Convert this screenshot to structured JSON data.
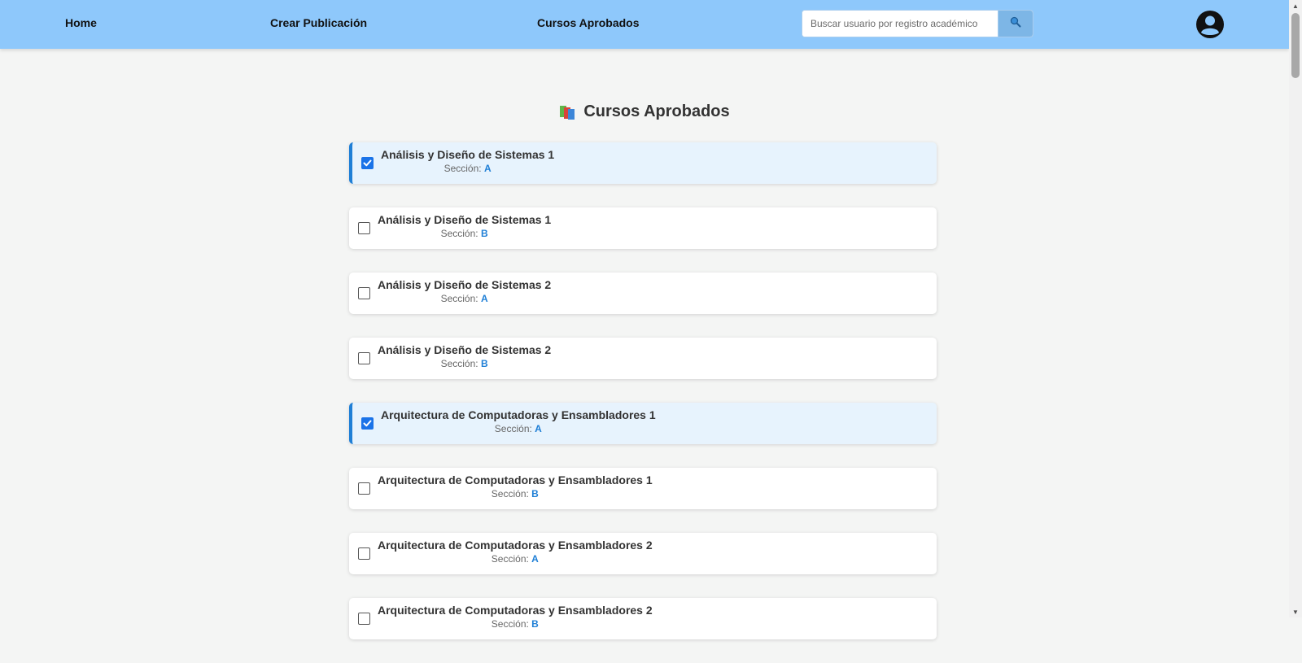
{
  "nav": {
    "home": "Home",
    "create_post": "Crear Publicación",
    "approved_courses": "Cursos Aprobados"
  },
  "search": {
    "placeholder": "Buscar usuario por registro académico",
    "value": "",
    "button_icon": "search-icon"
  },
  "user": {
    "icon": "user-avatar-icon"
  },
  "page": {
    "title": "Cursos Aprobados",
    "title_icon": "books-icon"
  },
  "section_label": "Sección:",
  "colors": {
    "navbar": "#8ec8fb",
    "accent": "#1f7fd6",
    "checked_bg": "#e7f3fd"
  },
  "courses": [
    {
      "name": "Análisis y Diseño de Sistemas 1",
      "section": "A",
      "checked": true
    },
    {
      "name": "Análisis y Diseño de Sistemas 1",
      "section": "B",
      "checked": false
    },
    {
      "name": "Análisis y Diseño de Sistemas 2",
      "section": "A",
      "checked": false
    },
    {
      "name": "Análisis y Diseño de Sistemas 2",
      "section": "B",
      "checked": false
    },
    {
      "name": "Arquitectura de Computadoras y Ensambladores 1",
      "section": "A",
      "checked": true
    },
    {
      "name": "Arquitectura de Computadoras y Ensambladores 1",
      "section": "B",
      "checked": false
    },
    {
      "name": "Arquitectura de Computadoras y Ensambladores 2",
      "section": "A",
      "checked": false
    },
    {
      "name": "Arquitectura de Computadoras y Ensambladores 2",
      "section": "B",
      "checked": false
    }
  ]
}
